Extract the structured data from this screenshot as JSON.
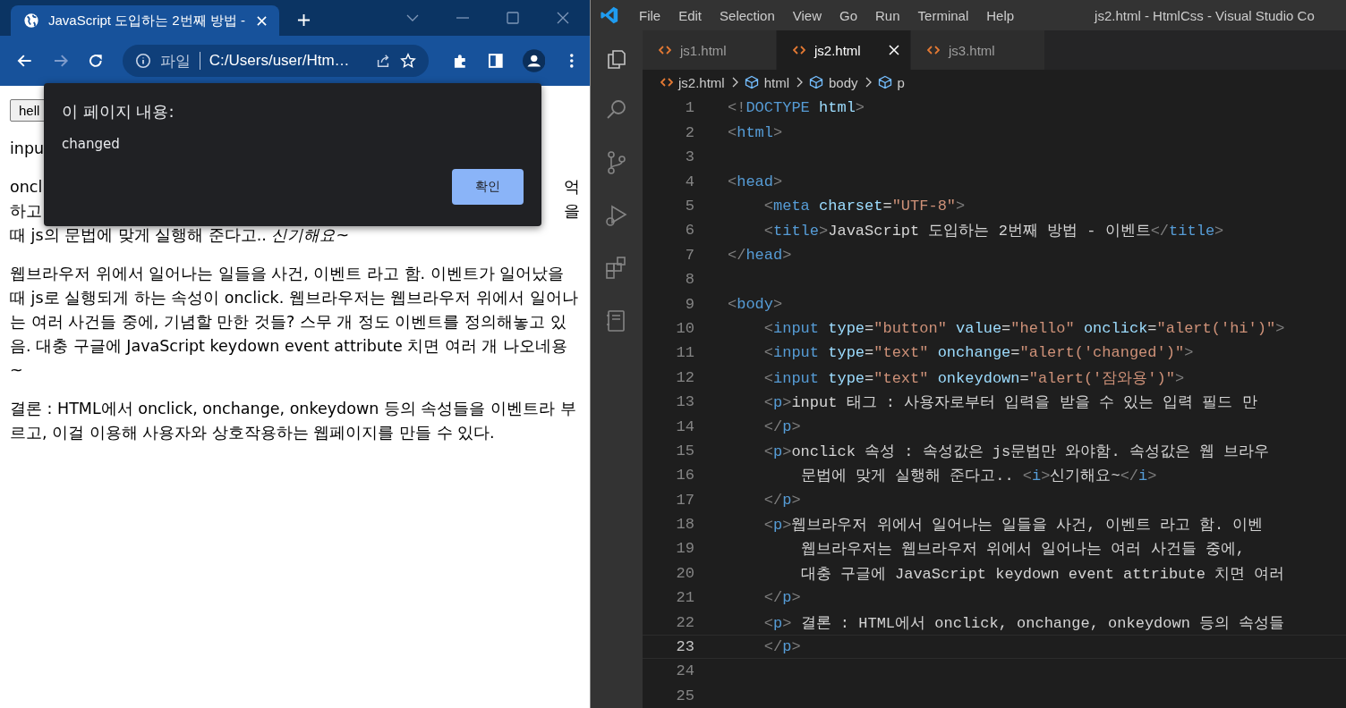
{
  "browser": {
    "tab": {
      "title": "JavaScript 도입하는 2번째 방법 -"
    },
    "toolbar": {
      "back_disabled": false,
      "forward_disabled": true,
      "scheme_label": "파일",
      "url": "C:/Users/user/Htm…"
    },
    "page": {
      "hello_button": "hell",
      "line_1": "inpu",
      "partial_rows": [
        {
          "left": "oncl",
          "right": "억"
        },
        {
          "left": "하고",
          "right": "을"
        }
      ],
      "paragraphs": [
        "때 js의 문법에 맞게 실행해 준다고.. *신기해요~*",
        "웹브라우저 위에서 일어나는 일들을 사건, 이벤트 라고 함. 이벤트가 일어났을 때 js로 실행되게 하는 속성이 onclick. 웹브라우저는 웹브라우저 위에서 일어나는 여러 사건들 중에, 기념할 만한 것들? 스무 개 정도 이벤트를 정의해놓고 있음. 대충 구글에 JavaScript keydown event attribute 치면 여러 개 나오네용~",
        "결론 : HTML에서 onclick, onchange, onkeydown 등의 속성들을 이벤트라 부르고, 이걸 이용해 사용자와 상호작용하는 웹페이지를 만들 수 있다."
      ]
    },
    "dialog": {
      "title": "이 페이지 내용:",
      "message": "changed",
      "ok": "확인"
    }
  },
  "vscode": {
    "menu": [
      "File",
      "Edit",
      "Selection",
      "View",
      "Go",
      "Run",
      "Terminal",
      "Help"
    ],
    "title": "js2.html - HtmlCss - Visual Studio Co",
    "tabs": [
      {
        "label": "js1.html",
        "selected": false
      },
      {
        "label": "js2.html",
        "selected": true
      },
      {
        "label": "js3.html",
        "selected": false
      }
    ],
    "breadcrumb": [
      {
        "label": "js2.html",
        "kind": "file"
      },
      {
        "label": "html",
        "kind": "element"
      },
      {
        "label": "body",
        "kind": "element"
      },
      {
        "label": "p",
        "kind": "element"
      }
    ],
    "lines": [
      {
        "n": "1",
        "current": false,
        "tokens": [
          {
            "kind": "punct",
            "t": "<!"
          },
          {
            "kind": "tag",
            "t": "DOCTYPE "
          },
          {
            "kind": "attr",
            "t": "html"
          },
          {
            "kind": "punct",
            "t": ">"
          }
        ]
      },
      {
        "n": "2",
        "current": false,
        "tokens": [
          {
            "kind": "punct",
            "t": "<"
          },
          {
            "kind": "tag",
            "t": "html"
          },
          {
            "kind": "punct",
            "t": ">"
          }
        ]
      },
      {
        "n": "3",
        "current": false
      },
      {
        "n": "4",
        "current": false,
        "tokens": [
          {
            "kind": "punct",
            "t": "<"
          },
          {
            "kind": "tag",
            "t": "head"
          },
          {
            "kind": "punct",
            "t": ">"
          }
        ]
      },
      {
        "n": "5",
        "current": false,
        "tokens": [
          {
            "kind": "punct",
            "t": "    <"
          },
          {
            "kind": "tag",
            "t": "meta "
          },
          {
            "kind": "attr",
            "t": "charset"
          },
          {
            "kind": "text",
            "t": "="
          },
          {
            "kind": "str",
            "t": "\"UTF-8\""
          },
          {
            "kind": "punct",
            "t": ">"
          }
        ]
      },
      {
        "n": "6",
        "current": false,
        "tokens": [
          {
            "kind": "punct",
            "t": "    <"
          },
          {
            "kind": "tag",
            "t": "title"
          },
          {
            "kind": "punct",
            "t": ">"
          },
          {
            "kind": "text",
            "t": "JavaScript 도입하는 2번째 방법 - 이벤트"
          },
          {
            "kind": "punct",
            "t": "</"
          },
          {
            "kind": "tag",
            "t": "title"
          },
          {
            "kind": "punct",
            "t": ">"
          }
        ]
      },
      {
        "n": "7",
        "current": false,
        "tokens": [
          {
            "kind": "punct",
            "t": "</"
          },
          {
            "kind": "tag",
            "t": "head"
          },
          {
            "kind": "punct",
            "t": ">"
          }
        ]
      },
      {
        "n": "8",
        "current": false
      },
      {
        "n": "9",
        "current": false,
        "tokens": [
          {
            "kind": "punct",
            "t": "<"
          },
          {
            "kind": "tag",
            "t": "body"
          },
          {
            "kind": "punct",
            "t": ">"
          }
        ]
      },
      {
        "n": "10",
        "current": false,
        "tokens": [
          {
            "kind": "punct",
            "t": "    <"
          },
          {
            "kind": "tag",
            "t": "input "
          },
          {
            "kind": "attr",
            "t": "type"
          },
          {
            "kind": "text",
            "t": "="
          },
          {
            "kind": "str",
            "t": "\"button\" "
          },
          {
            "kind": "attr",
            "t": "value"
          },
          {
            "kind": "text",
            "t": "="
          },
          {
            "kind": "str",
            "t": "\"hello\" "
          },
          {
            "kind": "attr",
            "t": "onclick"
          },
          {
            "kind": "text",
            "t": "="
          },
          {
            "kind": "str",
            "t": "\"alert('hi')\""
          },
          {
            "kind": "punct",
            "t": ">"
          }
        ]
      },
      {
        "n": "11",
        "current": false,
        "tokens": [
          {
            "kind": "punct",
            "t": "    <"
          },
          {
            "kind": "tag",
            "t": "input "
          },
          {
            "kind": "attr",
            "t": "type"
          },
          {
            "kind": "text",
            "t": "="
          },
          {
            "kind": "str",
            "t": "\"text\" "
          },
          {
            "kind": "attr",
            "t": "onchange"
          },
          {
            "kind": "text",
            "t": "="
          },
          {
            "kind": "str",
            "t": "\"alert('changed')\""
          },
          {
            "kind": "punct",
            "t": ">"
          }
        ]
      },
      {
        "n": "12",
        "current": false,
        "tokens": [
          {
            "kind": "punct",
            "t": "    <"
          },
          {
            "kind": "tag",
            "t": "input "
          },
          {
            "kind": "attr",
            "t": "type"
          },
          {
            "kind": "text",
            "t": "="
          },
          {
            "kind": "str",
            "t": "\"text\" "
          },
          {
            "kind": "attr",
            "t": "onkeydown"
          },
          {
            "kind": "text",
            "t": "="
          },
          {
            "kind": "str",
            "t": "\"alert('잠와용')\""
          },
          {
            "kind": "punct",
            "t": ">"
          }
        ]
      },
      {
        "n": "13",
        "current": false,
        "tokens": [
          {
            "kind": "punct",
            "t": "    <"
          },
          {
            "kind": "tag",
            "t": "p"
          },
          {
            "kind": "punct",
            "t": ">"
          },
          {
            "kind": "text",
            "t": "input 태그 : 사용자로부터 입력을 받을 수 있는 입력 필드 만"
          }
        ]
      },
      {
        "n": "14",
        "current": false,
        "tokens": [
          {
            "kind": "punct",
            "t": "    </"
          },
          {
            "kind": "tag",
            "t": "p"
          },
          {
            "kind": "punct",
            "t": ">"
          }
        ]
      },
      {
        "n": "15",
        "current": false,
        "tokens": [
          {
            "kind": "punct",
            "t": "    <"
          },
          {
            "kind": "tag",
            "t": "p"
          },
          {
            "kind": "punct",
            "t": ">"
          },
          {
            "kind": "text",
            "t": "onclick 속성 : 속성값은 js문법만 와야함. 속성값은 웹 브라우"
          }
        ]
      },
      {
        "n": "16",
        "current": false,
        "tokens": [
          {
            "kind": "text",
            "t": "        문법에 맞게 실행해 준다고.. "
          },
          {
            "kind": "punct",
            "t": "<"
          },
          {
            "kind": "tag",
            "t": "i"
          },
          {
            "kind": "punct",
            "t": ">"
          },
          {
            "kind": "text",
            "t": "신기해요~"
          },
          {
            "kind": "punct",
            "t": "</"
          },
          {
            "kind": "tag",
            "t": "i"
          },
          {
            "kind": "punct",
            "t": ">"
          }
        ]
      },
      {
        "n": "17",
        "current": false,
        "tokens": [
          {
            "kind": "punct",
            "t": "    </"
          },
          {
            "kind": "tag",
            "t": "p"
          },
          {
            "kind": "punct",
            "t": ">"
          }
        ]
      },
      {
        "n": "18",
        "current": false,
        "tokens": [
          {
            "kind": "punct",
            "t": "    <"
          },
          {
            "kind": "tag",
            "t": "p"
          },
          {
            "kind": "punct",
            "t": ">"
          },
          {
            "kind": "text",
            "t": "웹브라우저 위에서 일어나는 일들을 사건, 이벤트 라고 함. 이벤"
          }
        ]
      },
      {
        "n": "19",
        "current": false,
        "tokens": [
          {
            "kind": "text",
            "t": "        웹브라우저는 웹브라우저 위에서 일어나는 여러 사건들 중에,"
          }
        ]
      },
      {
        "n": "20",
        "current": false,
        "tokens": [
          {
            "kind": "text",
            "t": "        대충 구글에 JavaScript keydown event attribute 치면 여러"
          }
        ]
      },
      {
        "n": "21",
        "current": false,
        "tokens": [
          {
            "kind": "punct",
            "t": "    </"
          },
          {
            "kind": "tag",
            "t": "p"
          },
          {
            "kind": "punct",
            "t": ">"
          }
        ]
      },
      {
        "n": "22",
        "current": false,
        "tokens": [
          {
            "kind": "punct",
            "t": "    <"
          },
          {
            "kind": "tag",
            "t": "p"
          },
          {
            "kind": "punct",
            "t": ">"
          },
          {
            "kind": "text",
            "t": " 결론 : HTML에서 onclick, onchange, onkeydown 등의 속성들"
          }
        ]
      },
      {
        "n": "23",
        "current": true,
        "tokens": [
          {
            "kind": "punct",
            "t": "    </"
          },
          {
            "kind": "tag",
            "t": "p"
          },
          {
            "kind": "punct",
            "t": ">"
          }
        ]
      },
      {
        "n": "24",
        "current": false
      },
      {
        "n": "25",
        "current": false
      }
    ]
  }
}
